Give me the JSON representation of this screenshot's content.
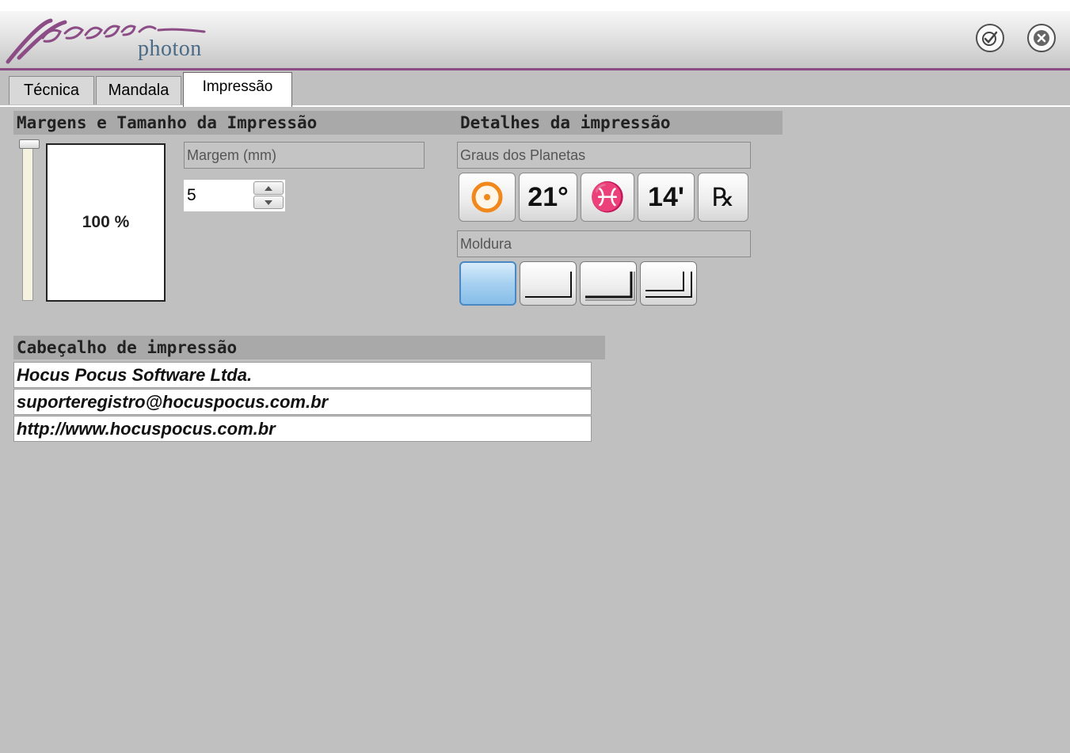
{
  "app": {
    "logo_word": "photon",
    "logo_script": "pegasus"
  },
  "titlebar": {
    "confirm_icon": "check-circle-icon",
    "close_icon": "close-circle-icon"
  },
  "tabs": [
    {
      "label": "Técnica",
      "active": false
    },
    {
      "label": "Mandala",
      "active": false
    },
    {
      "label": "Impressão",
      "active": true
    }
  ],
  "margins": {
    "header": "Margens e Tamanho da Impressão",
    "scale_label": "100 %",
    "margin_label": "Margem (mm)",
    "margin_value": "5"
  },
  "details": {
    "header": "Detalhes da impressão",
    "degrees_label": "Graus dos Planetas",
    "degree_buttons": [
      {
        "icon": "sun-symbol-icon",
        "text": ""
      },
      {
        "icon": "",
        "text": "21°"
      },
      {
        "icon": "",
        "text": "♓"
      },
      {
        "icon": "",
        "text": "14'"
      },
      {
        "icon": "",
        "text": "℞"
      }
    ],
    "frame_label": "Moldura",
    "frame_options": [
      "none",
      "single-line",
      "single-thick-line",
      "double-line"
    ],
    "frame_selected_index": 0
  },
  "print_header": {
    "header": "Cabeçalho de impressão",
    "lines": [
      "Hocus Pocus Software Ltda.",
      "suporteregistro@hocuspocus.com.br",
      "http://www.hocuspocus.com.br"
    ]
  },
  "colors": {
    "accent": "#8c4d86",
    "background": "#c0c0c0",
    "sun_orange": "#f0881c",
    "pisces_blue": "#1a2a8a"
  }
}
